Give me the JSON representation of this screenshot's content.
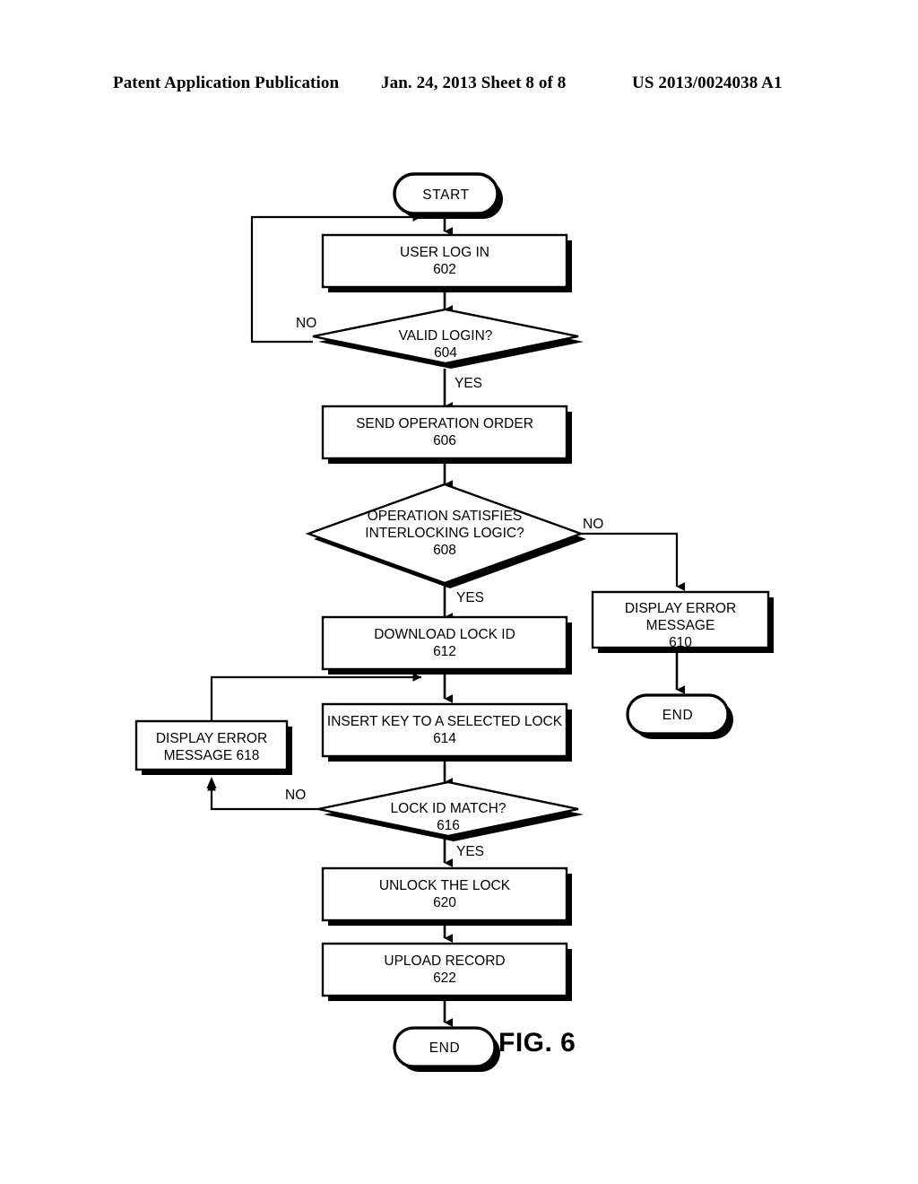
{
  "header": {
    "left": "Patent Application Publication",
    "middle": "Jan. 24, 2013  Sheet 8 of 8",
    "right": "US 2013/0024038 A1"
  },
  "figure": {
    "caption": "FIG. 6",
    "colors": {
      "stroke": "#000000",
      "fill": "#ffffff",
      "shadow": "#000000"
    }
  },
  "flowchart": {
    "type": "flowchart",
    "nodes": [
      {
        "id": "start",
        "shape": "terminator",
        "line1": "START",
        "line2": "",
        "ref": ""
      },
      {
        "id": "n602",
        "shape": "process",
        "line1": "USER LOG IN",
        "line2": "602",
        "ref": "602"
      },
      {
        "id": "n604",
        "shape": "decision",
        "line1": "VALID LOGIN?",
        "line2": "604",
        "ref": "604"
      },
      {
        "id": "n606",
        "shape": "process",
        "line1": "SEND OPERATION ORDER",
        "line2": "606",
        "ref": "606"
      },
      {
        "id": "n608",
        "shape": "decision",
        "line1": "OPERATION SATISFIES",
        "line2": "INTERLOCKING LOGIC?",
        "line3": "608",
        "ref": "608"
      },
      {
        "id": "n610",
        "shape": "process",
        "line1": "DISPLAY ERROR",
        "line2": "MESSAGE",
        "line3": "610",
        "ref": "610"
      },
      {
        "id": "end610",
        "shape": "terminator",
        "line1": "END",
        "line2": "",
        "ref": ""
      },
      {
        "id": "n612",
        "shape": "process",
        "line1": "DOWNLOAD LOCK ID",
        "line2": "612",
        "ref": "612"
      },
      {
        "id": "n614",
        "shape": "process",
        "line1": "INSERT KEY TO A SELECTED LOCK",
        "line2": "614",
        "ref": "614"
      },
      {
        "id": "n616",
        "shape": "decision",
        "line1": "LOCK ID MATCH?",
        "line2": "616",
        "ref": "616"
      },
      {
        "id": "n618",
        "shape": "process",
        "line1": "DISPLAY ERROR",
        "line2": "MESSAGE 618",
        "ref": "618"
      },
      {
        "id": "n620",
        "shape": "process",
        "line1": "UNLOCK THE LOCK",
        "line2": "620",
        "ref": "620"
      },
      {
        "id": "n622",
        "shape": "process",
        "line1": "UPLOAD RECORD",
        "line2": "622",
        "ref": "622"
      },
      {
        "id": "end622",
        "shape": "terminator",
        "line1": "END",
        "line2": "",
        "ref": ""
      }
    ],
    "edge_labels": [
      {
        "id": "e604-no",
        "text": "NO",
        "from": "n604",
        "to": "n602"
      },
      {
        "id": "e604-yes",
        "text": "YES",
        "from": "n604",
        "to": "n606"
      },
      {
        "id": "e608-no",
        "text": "NO",
        "from": "n608",
        "to": "n610"
      },
      {
        "id": "e608-yes",
        "text": "YES",
        "from": "n608",
        "to": "n612"
      },
      {
        "id": "e616-no",
        "text": "NO",
        "from": "n616",
        "to": "n618"
      },
      {
        "id": "e616-yes",
        "text": "YES",
        "from": "n616",
        "to": "n620"
      }
    ]
  }
}
